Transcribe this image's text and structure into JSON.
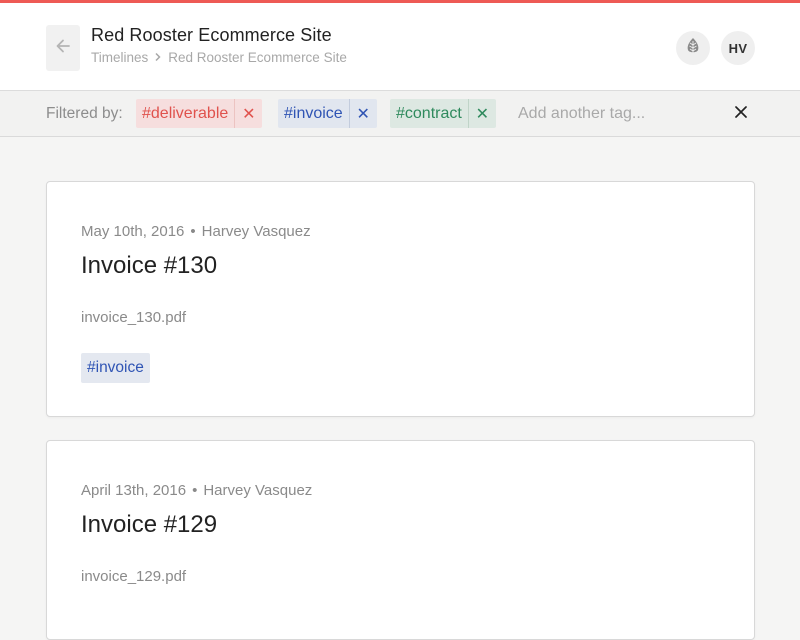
{
  "header": {
    "title": "Red Rooster Ecommerce Site",
    "breadcrumb": [
      "Timelines",
      "Red Rooster Ecommerce Site"
    ],
    "avatar_initials": "HV",
    "icons": {
      "back": "arrow-left-icon",
      "leaf": "leaf-icon"
    }
  },
  "filter": {
    "label": "Filtered by:",
    "tags": [
      {
        "label": "#deliverable",
        "color": "#e0524d",
        "bg": "#f6dede"
      },
      {
        "label": "#invoice",
        "color": "#2f54b4",
        "bg": "#e1e6ef"
      },
      {
        "label": "#contract",
        "color": "#2f8a5d",
        "bg": "#dde8e2"
      }
    ],
    "input_placeholder": "Add another tag...",
    "remove_symbol": "✕",
    "clear_symbol": "✕"
  },
  "cards": [
    {
      "date": "May 10th, 2016",
      "author": "Harvey Vasquez",
      "title": "Invoice #130",
      "file": "invoice_130.pdf",
      "tag": "#invoice"
    },
    {
      "date": "April 13th, 2016",
      "author": "Harvey Vasquez",
      "title": "Invoice #129",
      "file": "invoice_129.pdf"
    }
  ],
  "colors": {
    "accent": "#ee5a55",
    "tag_blue": "#2f54b4"
  }
}
